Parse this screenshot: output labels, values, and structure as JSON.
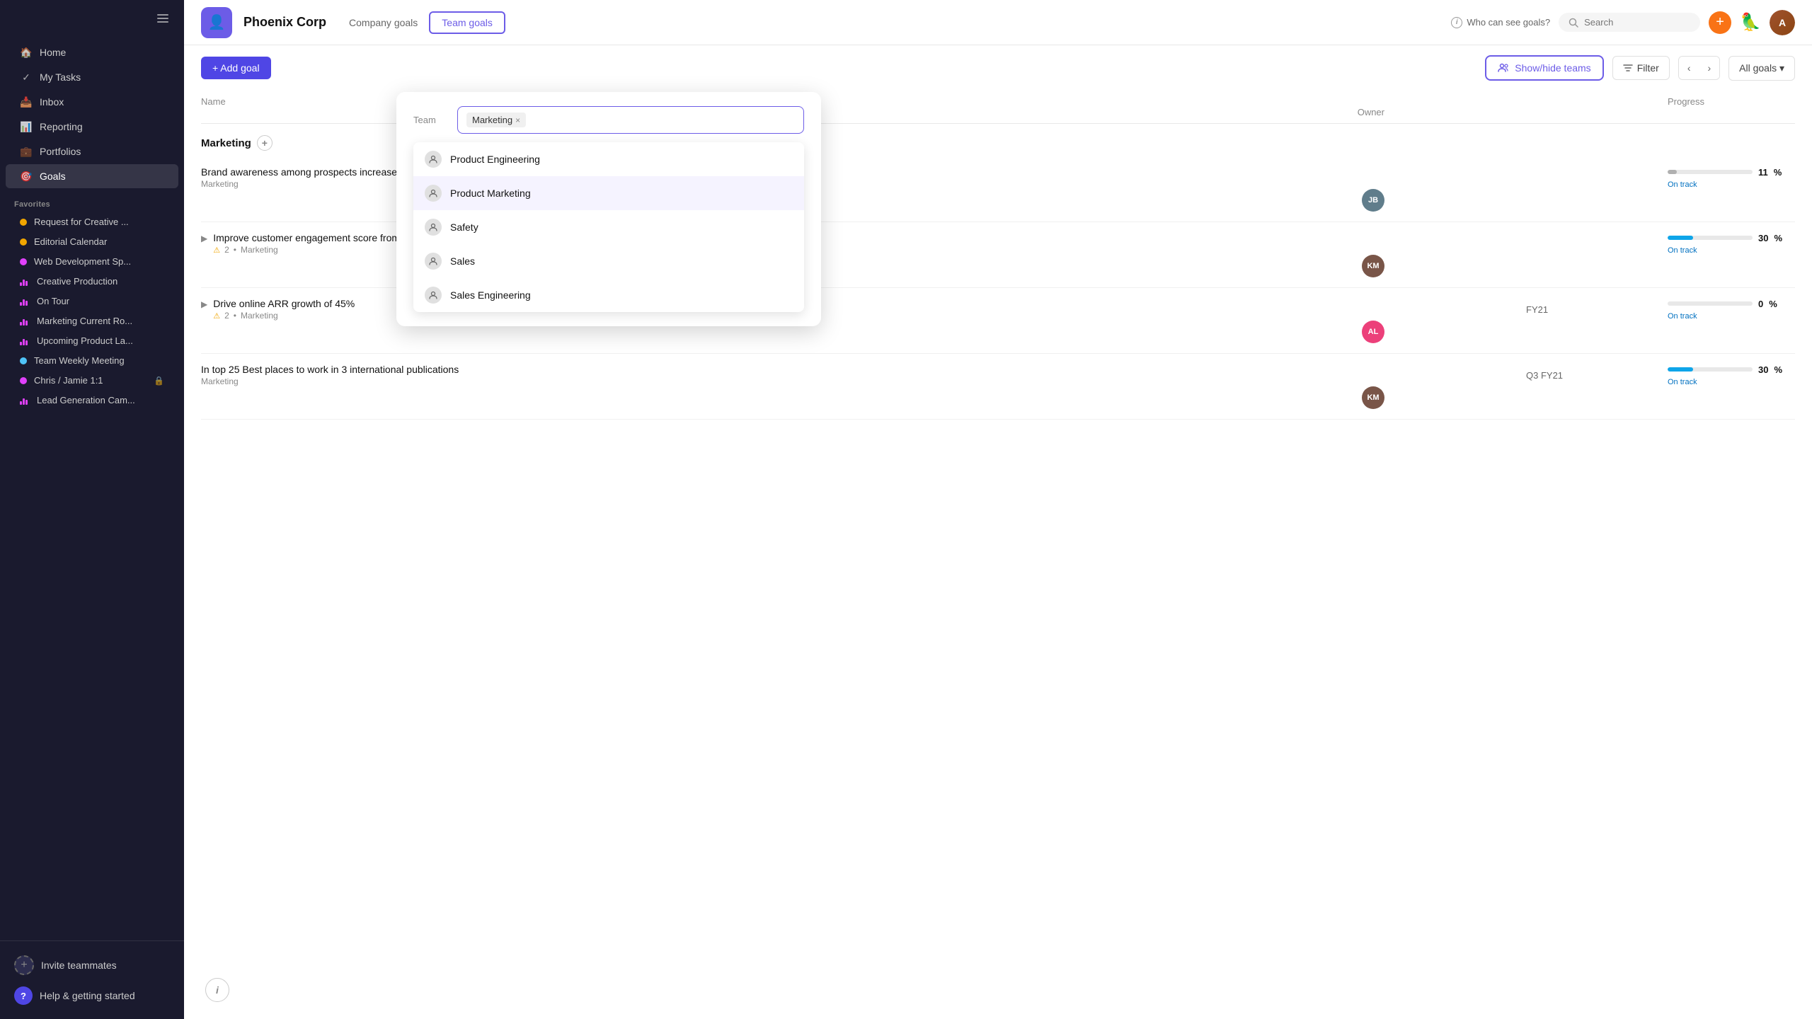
{
  "sidebar": {
    "toggle_label": "Toggle sidebar",
    "nav_items": [
      {
        "id": "home",
        "label": "Home",
        "icon": "home"
      },
      {
        "id": "my-tasks",
        "label": "My Tasks",
        "icon": "check-circle"
      },
      {
        "id": "inbox",
        "label": "Inbox",
        "icon": "inbox"
      },
      {
        "id": "reporting",
        "label": "Reporting",
        "icon": "chart-bar"
      },
      {
        "id": "portfolios",
        "label": "Portfolios",
        "icon": "briefcase"
      },
      {
        "id": "goals",
        "label": "Goals",
        "icon": "person-circle",
        "active": true
      }
    ],
    "favorites_label": "Favorites",
    "favorites": [
      {
        "id": "request-creative",
        "label": "Request for Creative ...",
        "dot_color": "#f0a500",
        "icon": "dot"
      },
      {
        "id": "editorial-calendar",
        "label": "Editorial Calendar",
        "dot_color": "#f0a500",
        "icon": "dot"
      },
      {
        "id": "web-development",
        "label": "Web Development Sp...",
        "dot_color": "#e040fb",
        "icon": "dot"
      },
      {
        "id": "creative-production",
        "label": "Creative Production",
        "dot_color": "#e040fb",
        "icon": "bar"
      },
      {
        "id": "on-tour",
        "label": "On Tour",
        "dot_color": "#e040fb",
        "icon": "bar"
      },
      {
        "id": "marketing-current",
        "label": "Marketing Current Ro...",
        "dot_color": "#e040fb",
        "icon": "bar"
      },
      {
        "id": "upcoming-product",
        "label": "Upcoming Product La...",
        "dot_color": "#e040fb",
        "icon": "bar"
      },
      {
        "id": "team-weekly",
        "label": "Team Weekly Meeting",
        "dot_color": "#4fc3f7",
        "icon": "dot"
      },
      {
        "id": "chris-jamie",
        "label": "Chris / Jamie 1:1",
        "dot_color": "#e040fb",
        "icon": "dot",
        "lock": true
      },
      {
        "id": "lead-generation",
        "label": "Lead Generation Cam...",
        "dot_color": "#e040fb",
        "icon": "bar"
      }
    ],
    "invite_teammates": "Invite teammates",
    "help_label": "Help & getting started"
  },
  "header": {
    "logo_emoji": "👤",
    "company": "Phoenix Corp",
    "tabs": [
      {
        "id": "company-goals",
        "label": "Company goals",
        "active": false
      },
      {
        "id": "team-goals",
        "label": "Team goals",
        "active": true
      }
    ],
    "who_can_see": "Who can see goals?",
    "search_placeholder": "Search",
    "add_btn_label": "+",
    "bird_emoji": "🦜"
  },
  "toolbar": {
    "add_goal_label": "+ Add goal",
    "show_hide_label": "Show/hide teams",
    "filter_label": "Filter",
    "prev_label": "‹",
    "next_label": "›",
    "all_goals_label": "All goals"
  },
  "table": {
    "columns": [
      "Name",
      "",
      "",
      "Progress",
      "Owner"
    ],
    "section": "Marketing",
    "rows": [
      {
        "id": "row1",
        "name": "Brand awareness among prospects increases by 25%",
        "sub": "Marketing",
        "period": "",
        "progress": 11,
        "status": "On track",
        "bar_color": "#b0b0b0",
        "owner_initials": "JB",
        "owner_color": "#607d8b"
      },
      {
        "id": "row2",
        "name": "Improve customer engagement score from 4.2 to 4.7",
        "sub": "Marketing",
        "period": "",
        "progress": 30,
        "status": "On track",
        "bar_color": "#0ea5e9",
        "has_children": true,
        "warning_count": "2",
        "owner_initials": "KM",
        "owner_color": "#795548"
      },
      {
        "id": "row3",
        "name": "Drive online ARR growth of 45%",
        "sub": "Marketing",
        "period": "FY21",
        "progress": 0,
        "status": "On track",
        "bar_color": "#b0b0b0",
        "has_children": true,
        "warning_count": "2",
        "owner_initials": "AL",
        "owner_color": "#ec407a"
      },
      {
        "id": "row4",
        "name": "In top 25 Best places to work in 3 international publications",
        "sub": "Marketing",
        "period": "Q3 FY21",
        "progress": 30,
        "status": "On track",
        "bar_color": "#0ea5e9",
        "owner_initials": "KM",
        "owner_color": "#795548"
      }
    ]
  },
  "dropdown": {
    "team_label": "Team",
    "selected_tag": "Marketing",
    "cursor_visible": true,
    "options": [
      {
        "id": "product-engineering",
        "label": "Product Engineering"
      },
      {
        "id": "product-marketing",
        "label": "Product Marketing",
        "highlighted": true
      },
      {
        "id": "safety",
        "label": "Safety"
      },
      {
        "id": "sales",
        "label": "Sales"
      },
      {
        "id": "sales-engineering",
        "label": "Sales Engineering"
      }
    ]
  },
  "colors": {
    "accent": "#6c5ce7",
    "sidebar_bg": "#1a1a2e",
    "add_btn": "#f97316"
  }
}
